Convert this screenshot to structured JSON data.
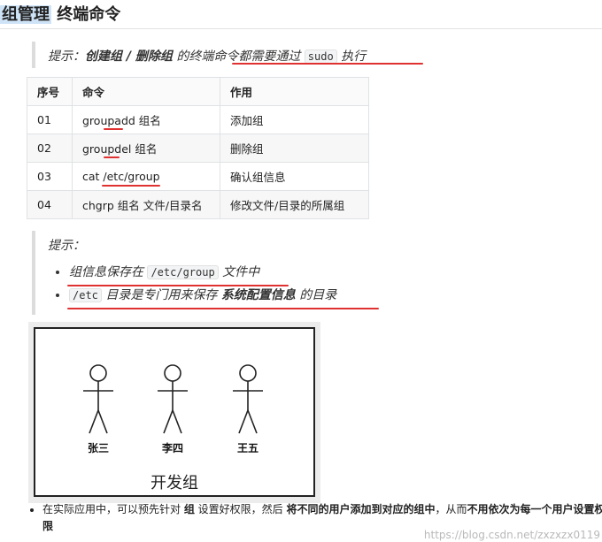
{
  "title": {
    "highlight": "组管理",
    "rest": " 终端命令"
  },
  "tip1": {
    "prefix": "提示：",
    "create": "创建组",
    "slash": " / ",
    "delete": "删除组",
    "mid": " 的终端命令都需要通过 ",
    "code": "sudo",
    "suffix": " 执行"
  },
  "table": {
    "headers": [
      "序号",
      "命令",
      "作用"
    ],
    "rows": [
      [
        "01",
        "groupadd 组名",
        "添加组"
      ],
      [
        "02",
        "groupdel 组名",
        "删除组"
      ],
      [
        "03",
        "cat /etc/group",
        "确认组信息"
      ],
      [
        "04",
        "chgrp 组名 文件/目录名",
        "修改文件/目录的所属组"
      ]
    ]
  },
  "tip2": {
    "label": "提示：",
    "item1": {
      "pre": "组信息保存在 ",
      "code": "/etc/group",
      "post": " 文件中"
    },
    "item2": {
      "code": "/etc",
      "pre": " 目录是专门用来保存 ",
      "bold": "系统配置信息",
      "post": " 的目录"
    }
  },
  "figure": {
    "people": [
      "张三",
      "李四",
      "王五"
    ],
    "group": "开发组"
  },
  "bottom": {
    "t1": "在实际应用中，可以预先针对 ",
    "b1": "组",
    "t2": " 设置好权限，然后 ",
    "b2": "将不同的用户添加到对应的组中",
    "t3": "，从而",
    "b3": "不用依次为每一个用户设置权限"
  },
  "watermark": "https://blog.csdn.net/zxzxzx0119"
}
